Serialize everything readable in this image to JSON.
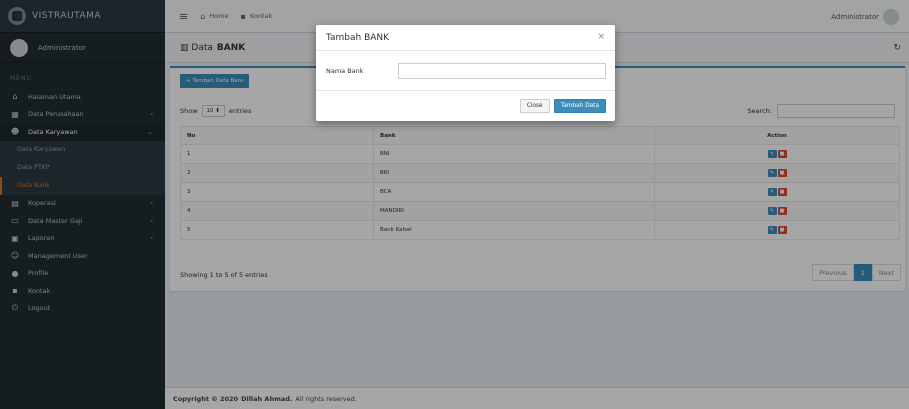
{
  "app": {
    "logo_text": "VISTRAUTAMA",
    "user_name": "Administrator",
    "menu_header": "MENU"
  },
  "sidebar": {
    "items": [
      {
        "label": "Halaman Utama",
        "icon": "dashboard-icon"
      },
      {
        "label": "Data Perusahaan",
        "icon": "building-icon",
        "chevron": "‹"
      },
      {
        "label": "Data Karyawan",
        "icon": "users-icon",
        "chevron": "⌄"
      },
      {
        "label": "Koperasi",
        "icon": "bank-icon",
        "chevron": "‹"
      },
      {
        "label": "Data Master Gaji",
        "icon": "money-icon",
        "chevron": "‹"
      },
      {
        "label": "Laporan",
        "icon": "report-icon",
        "chevron": "‹"
      },
      {
        "label": "Management User",
        "icon": "users-cog-icon"
      },
      {
        "label": "Profile",
        "icon": "user-icon"
      },
      {
        "label": "Kontak",
        "icon": "contact-icon"
      },
      {
        "label": "Logout",
        "icon": "power-icon"
      }
    ],
    "subitems": [
      {
        "label": "Data Karyawan"
      },
      {
        "label": "Data PTKP"
      },
      {
        "label": "Data Bank"
      }
    ]
  },
  "topbar": {
    "home": "Home",
    "kontak": "Kontak",
    "admin": "Administrator"
  },
  "page": {
    "title_prefix": "Data",
    "title": "BANK"
  },
  "box": {
    "add_button": "Tambah Data Baru",
    "show_label": "Show",
    "entries_value": "10",
    "entries_label": "entries",
    "search_label": "Search:",
    "columns": [
      "No",
      "Bank",
      "Action"
    ],
    "rows": [
      {
        "no": "1",
        "bank": "BNI"
      },
      {
        "no": "2",
        "bank": "BRI"
      },
      {
        "no": "3",
        "bank": "BCA"
      },
      {
        "no": "4",
        "bank": "MANDIRI"
      },
      {
        "no": "5",
        "bank": "Bank Kalsel"
      }
    ],
    "showing": "Showing 1 to 5 of 5 entries",
    "pager": {
      "prev": "Previous",
      "page": "1",
      "next": "Next"
    }
  },
  "footer": {
    "prefix": "Copyright © 2020",
    "author": "Dillah Ahmad.",
    "suffix": "All rights reserved."
  },
  "modal": {
    "title": "Tambah BANK",
    "close_glyph": "×",
    "field_label": "Nama Bank",
    "field_value": "",
    "close_button": "Close",
    "submit_button": "Tambah Data"
  },
  "colors": {
    "sidebar_bg": "#222d32",
    "primary": "#3c8dbc",
    "danger": "#dd4b39",
    "active_sub": "#d07a2b"
  }
}
